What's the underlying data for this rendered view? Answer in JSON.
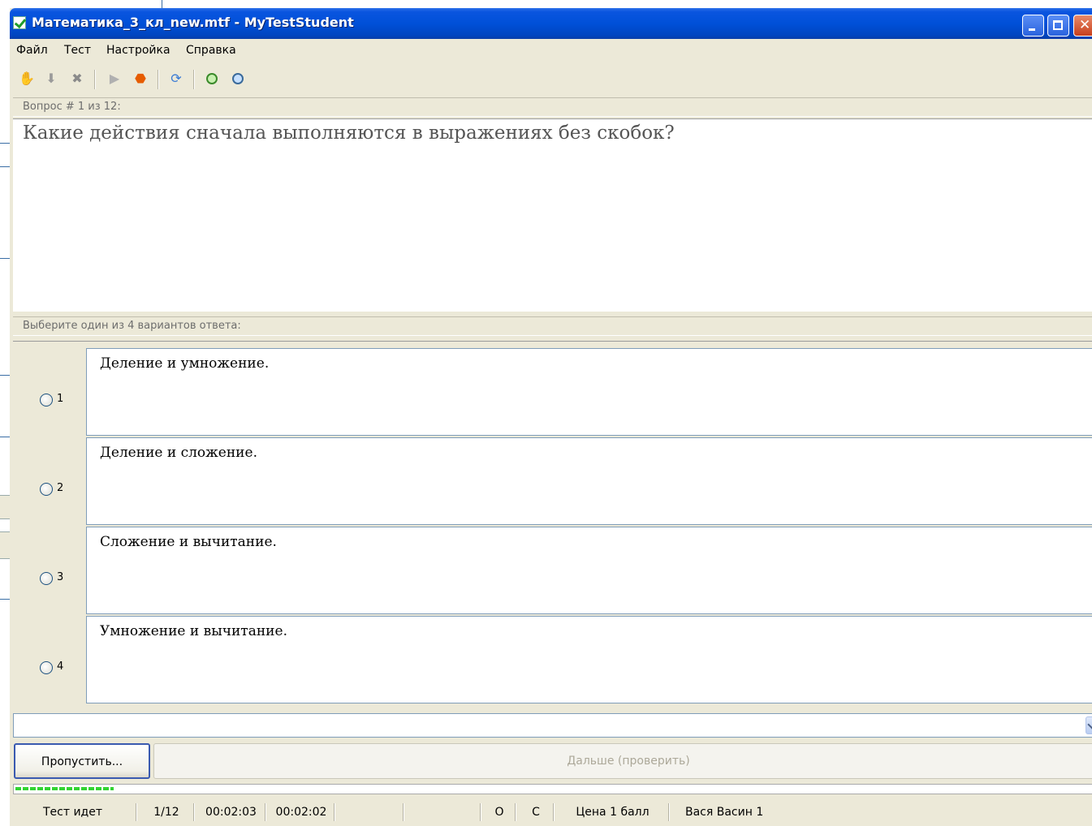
{
  "window": {
    "title": "Математика_3_кл_new.mtf - MyTestStudent"
  },
  "menu": {
    "items": [
      "Файл",
      "Тест",
      "Настройка",
      "Справка"
    ]
  },
  "toolbar": {
    "icons": [
      "hand-icon",
      "down-arrow-icon",
      "delete-icon",
      "play-icon",
      "stop-icon",
      "refresh-icon",
      "zoom-in-icon",
      "zoom-out-icon"
    ]
  },
  "question": {
    "header": "Вопрос # 1 из 12:",
    "text": "Какие действия сначала выполняются в выражениях без скобок?"
  },
  "answers": {
    "header": "Выберите один из 4 вариантов ответа:",
    "options": [
      {
        "num": "1",
        "text": "Деление и умножение."
      },
      {
        "num": "2",
        "text": "Деление и сложение."
      },
      {
        "num": "3",
        "text": "Сложение и вычитание."
      },
      {
        "num": "4",
        "text": "Умножение и вычитание."
      }
    ]
  },
  "buttons": {
    "skip": "Пропустить...",
    "next": "Дальше (проверить)"
  },
  "progress": {
    "value": 0.09
  },
  "status": {
    "state": "Тест идет",
    "counter": "1/12",
    "time_elapsed": "00:02:03",
    "time_left": "00:02:02",
    "o": "О",
    "c": "С",
    "price": "Цена 1 балл",
    "user": "Вася Васин 1"
  }
}
